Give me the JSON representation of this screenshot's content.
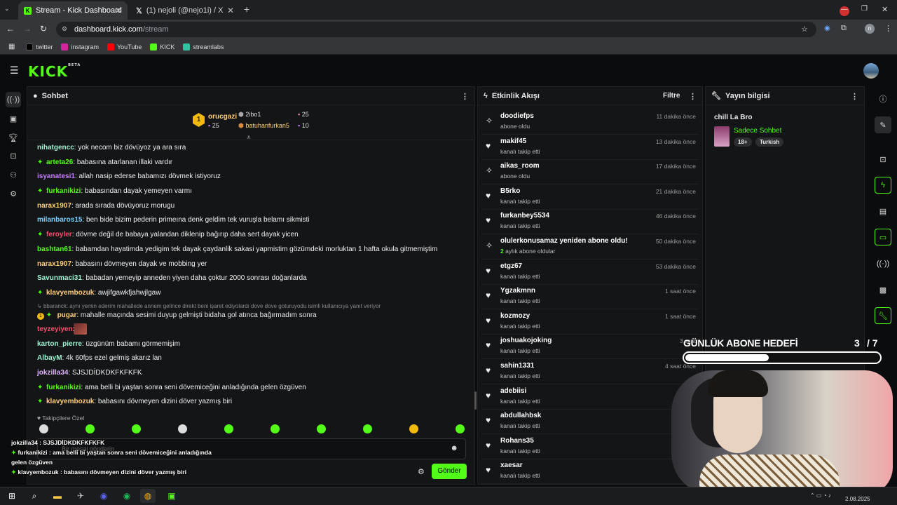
{
  "browser": {
    "tabs": [
      {
        "title": "Stream - Kick Dashboard",
        "active": true
      },
      {
        "title": "(1) nejoli (@nejo1i) / X",
        "active": false
      }
    ],
    "url_host": "dashboard.kick.com",
    "url_path": "/stream",
    "bookmarks": [
      "twitter",
      "instagram",
      "YouTube",
      "KICK",
      "streamlabs"
    ],
    "profile_initial": "n"
  },
  "kick": {
    "logo": "KICK",
    "beta": "BETA"
  },
  "chat": {
    "title": "Sohbet",
    "leaderboard": [
      {
        "rank": "1",
        "name": "orucgazi",
        "count": "25"
      },
      {
        "name": "2ibo1",
        "count": "25"
      },
      {
        "name": "batuhanfurkan5",
        "count": "10"
      }
    ],
    "messages": [
      {
        "user": "nihatgencc",
        "text": ": yok necom biz dövüyoz ya ara sıra",
        "color": "#9ef2d0",
        "badge": false
      },
      {
        "user": "arteta26",
        "text": ": babasına atarlanan illaki vardır",
        "color": "#53fc18",
        "badge": true
      },
      {
        "user": "isyanatesi1",
        "text": ": allah nasip ederse babamızı dövmek istiyoruz",
        "color": "#c77dff",
        "badge": false
      },
      {
        "user": "furkanikizi",
        "text": ": babasından dayak yemeyen varmı",
        "color": "#53fc18",
        "badge": true
      },
      {
        "user": "narax1907",
        "text": ": arada sırada dövüyoruz morugu",
        "color": "#ffcf7a",
        "badge": false
      },
      {
        "user": "milanbaros15",
        "text": ": ben bide bizim pederin primeına denk geldim tek vuruşla belamı sikmisti",
        "color": "#7ad1ff",
        "badge": false
      },
      {
        "user": "feroyler",
        "text": ": dövme değil de babaya yalandan diklenip bağırıp daha sert dayak yicen",
        "color": "#ff4d6d",
        "badge": true
      },
      {
        "user": "bashtan61",
        "text": ": babamdan hayatimda yedigim tek dayak çaydanlik sakasi yapmistim gözümdeki morluktan 1 hafta okula gitmemiştim",
        "color": "#53fc18",
        "badge": false
      },
      {
        "user": "narax1907",
        "text": ": babasını dövmeyen dayak ve mobbing yer",
        "color": "#ffcf7a",
        "badge": false
      },
      {
        "user": "Savunmaci31",
        "text": ": babadan yemeyip anneden yiyen daha çoktur 2000 sonrası doğanlarda",
        "color": "#9ef2d0",
        "badge": false
      },
      {
        "user": "klavyembozuk",
        "text": ": awjifgawkfjahwjlgaw",
        "color": "#ffcf7a",
        "badge": true
      }
    ],
    "reply_hint": "bbaranck: aynı yemin ederim mahallede annem gelince direkt beni işaret ediyolardı dove dove goturuyodu isimli kullanıcıya yanıt veriyor",
    "reply_msg": {
      "user": "pugar",
      "text": ": mahalle maçında sesimi duyup gelmişti bidaha gol atınca bağırmadım sonra"
    },
    "messages2": [
      {
        "user": "teyzeyiyen",
        "text": ":",
        "color": "#ff4d6d",
        "badge": false
      },
      {
        "user": "karton_pierre",
        "text": ": üzgünüm babamı görmemişim",
        "color": "#9ef2d0",
        "badge": false
      },
      {
        "user": "AlbayM",
        "text": ": 4k 60fps ezel gelmiş akarız lan",
        "color": "#9ef2d0",
        "badge": false
      },
      {
        "user": "jokzilla34",
        "text": ": SJSJDİDKDKFKFKFK",
        "color": "#e0b0ff",
        "badge": false
      },
      {
        "user": "furkanikizi",
        "text": ": ama belli bi yaştan sonra seni dövemiceğini anladığında gelen özgüven",
        "color": "#53fc18",
        "badge": true
      },
      {
        "user": "klavyembozuk",
        "text": ": babasını dövmeyen dizini döver yazmış biri",
        "color": "#ffcf7a",
        "badge": true
      }
    ],
    "followers_only": "Takipçilere Özel",
    "input_placeholder": "Bir mesaj gönderin",
    "send_label": "Gönder"
  },
  "overlay_chat": [
    {
      "user": "jokzilla34",
      "text": " : SJSJDİDKDKFKFKFK",
      "badge": false
    },
    {
      "user": "furkanikizi",
      "text": " : ama belli bi yaştan sonra seni dövemiceğini anladığında",
      "badge": true
    },
    {
      "user": "",
      "text": "gelen özgüven",
      "badge": false
    },
    {
      "user": "klavyembozuk",
      "text": " : babasını dövmeyen dizini döver yazmış biri",
      "badge": true
    }
  ],
  "activity": {
    "title": "Etkinlik Akışı",
    "filter_label": "Filtre",
    "events": [
      {
        "name": "doodiefps",
        "sub": "abone oldu",
        "time": "11 dakika önce",
        "icon": "sub"
      },
      {
        "name": "makif45",
        "sub": "kanalı takip etti",
        "time": "13 dakika önce",
        "icon": "heart"
      },
      {
        "name": "aikas_room",
        "sub": "abone oldu",
        "time": "17 dakika önce",
        "icon": "sub"
      },
      {
        "name": "B5rko",
        "sub": "kanalı takip etti",
        "time": "21 dakika önce",
        "icon": "heart"
      },
      {
        "name": "furkanbey5534",
        "sub": "kanalı takip etti",
        "time": "46 dakika önce",
        "icon": "heart"
      },
      {
        "name": "olulerkonusamaz yeniden abone oldu!",
        "sub_num": "2",
        "sub": " aylık abone oldular",
        "time": "50 dakika önce",
        "icon": "sub"
      },
      {
        "name": "etgz67",
        "sub": "kanalı takip etti",
        "time": "53 dakika önce",
        "icon": "heart"
      },
      {
        "name": "Ygzakmnn",
        "sub": "kanalı takip etti",
        "time": "1 saat önce",
        "icon": "heart"
      },
      {
        "name": "kozmozy",
        "sub": "kanalı takip etti",
        "time": "1 saat önce",
        "icon": "heart"
      },
      {
        "name": "joshuakojoking",
        "sub": "kanalı takip etti",
        "time": "3 saat",
        "icon": "heart"
      },
      {
        "name": "sahin1331",
        "sub": "kanalı takip etti",
        "time": "4 saat önce",
        "icon": "heart"
      },
      {
        "name": "adebiisi",
        "sub": "kanalı takip etti",
        "time": "5",
        "icon": "heart"
      },
      {
        "name": "abdullahbsk",
        "sub": "kanalı takip etti",
        "time": "9",
        "icon": "heart"
      },
      {
        "name": "Rohans35",
        "sub": "kanalı takip etti",
        "time": "9",
        "icon": "heart"
      },
      {
        "name": "xaesar",
        "sub": "kanalı takip etti",
        "time": "12",
        "icon": "heart"
      }
    ]
  },
  "stream_info": {
    "title": "Yayın bilgisi",
    "stream_title": "chill La Bro",
    "category": "Sadece Sohbet",
    "tags": [
      "18+",
      "Turkish"
    ]
  },
  "sub_goal": {
    "label": "GÜNLÜK ABONE HEDEFİ",
    "current": "3",
    "target": "/ 7",
    "progress": 0.43
  },
  "taskbar": {
    "date": "2.08.2025"
  }
}
